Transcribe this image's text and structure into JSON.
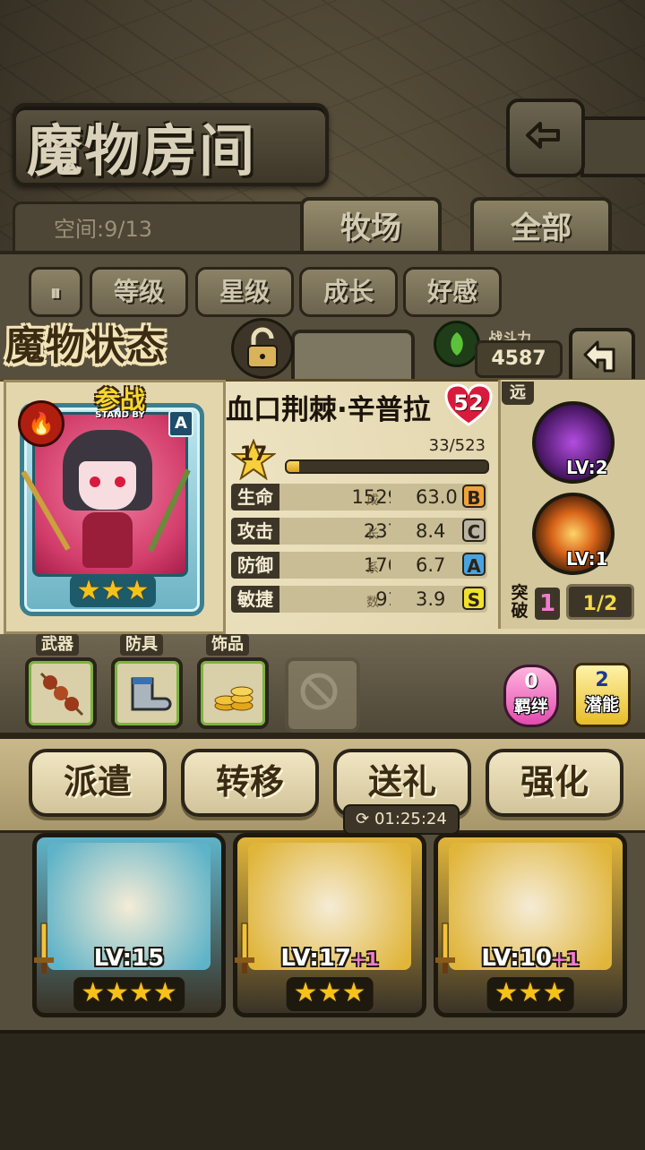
{
  "header": {
    "title": "魔物房间"
  },
  "space": {
    "label": "空间:9/13"
  },
  "tabs": [
    {
      "label": "牧场"
    },
    {
      "label": "全部"
    }
  ],
  "sort_buttons": [
    {
      "label": "等级"
    },
    {
      "label": "星级"
    },
    {
      "label": "成长"
    },
    {
      "label": "好感"
    }
  ],
  "status": {
    "title": "魔物状态",
    "power_label": "战斗力",
    "power_value": "4587"
  },
  "monster": {
    "name": "血口荆棘·辛普拉",
    "affection": "52",
    "standby_main": "参战",
    "standby_sub": "STAND BY",
    "rank": "A",
    "stars": 3,
    "level": "17",
    "xp_text": "33/523",
    "xp_fraction": 0.063,
    "element_icon": "fire-icon",
    "stats": [
      {
        "label": "生命",
        "value": "1529",
        "growth": "63.0",
        "grade": "B",
        "grade_color": "#f0a23a"
      },
      {
        "label": "攻击",
        "value": "237",
        "growth": "8.4",
        "grade": "C",
        "grade_color": "#b9b3a3"
      },
      {
        "label": "防御",
        "value": "176",
        "growth": "6.7",
        "grade": "A",
        "grade_color": "#4aa3e0"
      },
      {
        "label": "敏捷",
        "value": "91",
        "growth": "3.9",
        "grade": "S",
        "grade_color": "#f2e12a"
      }
    ],
    "growth_chars": [
      "成",
      "长",
      "系",
      "数"
    ]
  },
  "skills": {
    "range_tag": "远",
    "items": [
      {
        "name": "dark-skill-icon",
        "level": "LV:2",
        "color": "#5a1d7a"
      },
      {
        "name": "sword-skill-icon",
        "level": "LV:1",
        "color": "#d9651a"
      }
    ],
    "break_label": "突破",
    "break_count": "1",
    "break_progress": "1/2"
  },
  "equipment": [
    {
      "label": "武器",
      "icon": "meat-skewer-icon"
    },
    {
      "label": "防具",
      "icon": "boots-icon"
    },
    {
      "label": "饰品",
      "icon": "coins-icon"
    }
  ],
  "bond": {
    "count": "0",
    "label": "羁绊"
  },
  "potential": {
    "count": "2",
    "label": "潜能"
  },
  "actions": [
    {
      "label": "派遣"
    },
    {
      "label": "转移"
    },
    {
      "label": "送礼"
    },
    {
      "label": "强化"
    }
  ],
  "timer": "01:25:24",
  "cards": [
    {
      "level": "LV:15",
      "plus": "",
      "stars": 4,
      "color": "#5fb3c8"
    },
    {
      "level": "LV:17",
      "plus": "+1",
      "stars": 3,
      "color": "#e0b53a"
    },
    {
      "level": "LV:10",
      "plus": "+1",
      "stars": 3,
      "color": "#e0b53a"
    }
  ]
}
